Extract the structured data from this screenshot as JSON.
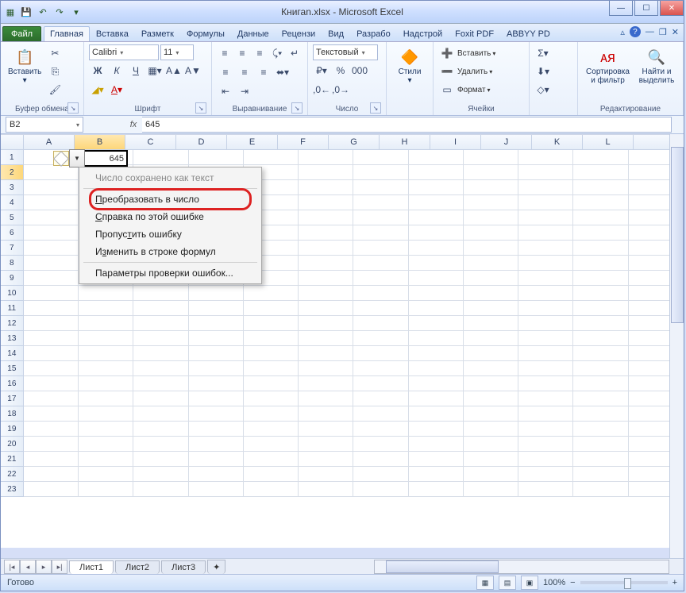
{
  "title": "Книгаn.xlsx - Microsoft Excel",
  "qat": {
    "save": "💾",
    "undo": "↶",
    "redo": "↷"
  },
  "file_tab": "Файл",
  "tabs": [
    "Главная",
    "Вставка",
    "Разметк",
    "Формулы",
    "Данные",
    "Рецензи",
    "Вид",
    "Разрабо",
    "Надстрой",
    "Foxit PDF",
    "ABBYY PD"
  ],
  "active_tab": 0,
  "ribbon": {
    "clipboard": {
      "paste": "Вставить",
      "label": "Буфер обмена"
    },
    "font": {
      "name": "Calibri",
      "size": "11",
      "label": "Шрифт"
    },
    "align": {
      "label": "Выравнивание"
    },
    "number": {
      "format": "Текстовый",
      "label": "Число"
    },
    "styles": {
      "btn": "Стили"
    },
    "cells": {
      "insert": "Вставить",
      "delete": "Удалить",
      "format": "Формат",
      "label": "Ячейки"
    },
    "editing": {
      "sort": "Сортировка и фильтр",
      "find": "Найти и выделить",
      "label": "Редактирование"
    }
  },
  "namebox": "B2",
  "fx_value": "645",
  "columns": [
    "A",
    "B",
    "C",
    "D",
    "E",
    "F",
    "G",
    "H",
    "I",
    "J",
    "K",
    "L"
  ],
  "selected_col": 1,
  "rows_count": 23,
  "selected_row": 2,
  "active_cell_value": "645",
  "context_menu": {
    "title": "Число сохранено как текст",
    "convert": "Преобразовать в число",
    "help": "Справка по этой ошибке",
    "skip": "Пропустить ошибку",
    "editbar": "Изменить в строке формул",
    "options": "Параметры проверки ошибок..."
  },
  "sheets": [
    "Лист1",
    "Лист2",
    "Лист3"
  ],
  "status": "Готово",
  "zoom": "100%"
}
